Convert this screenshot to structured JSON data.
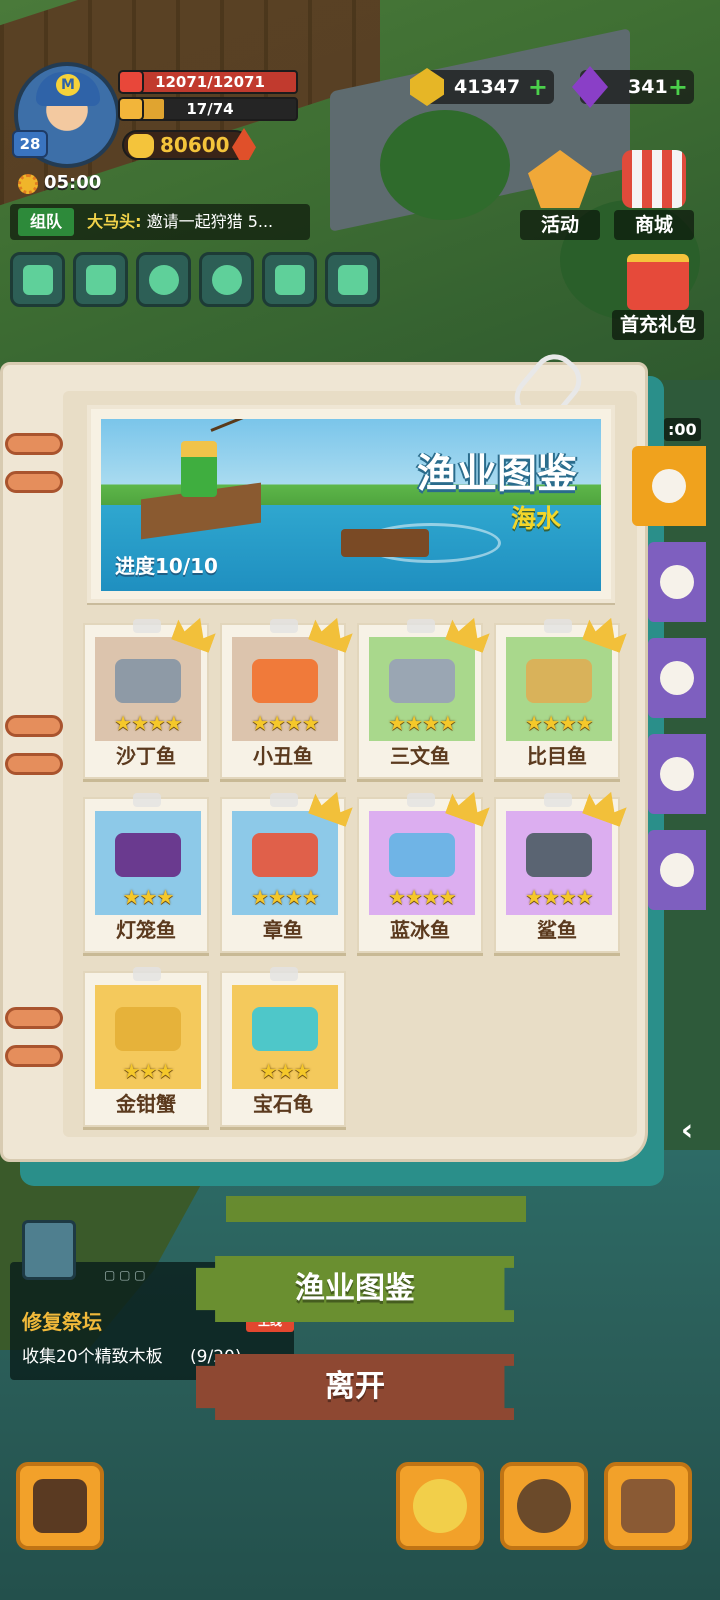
{
  "hud": {
    "player_level": "28",
    "hp_text": "12071/12071",
    "xp_text": "17/74",
    "xp_progress": 0.23,
    "power": "80600",
    "time": "05:00",
    "chat": {
      "tag": "组队",
      "sender": "大马头:",
      "message": "邀请一起狩猎 5..."
    },
    "coins": "41347",
    "gems": "341",
    "plus_symbol": "+",
    "quick_buttons": [
      "shuffle-icon",
      "mail-icon",
      "headset-icon",
      "chat-bubble-icon",
      "map-icon",
      "id-card-icon"
    ]
  },
  "shop": {
    "events_label": "活动",
    "mall_label": "商城",
    "gift_label": "首充礼包",
    "side_timer": ":00"
  },
  "codex": {
    "title": "渔业图鉴",
    "subtitle": "海水",
    "progress": "进度10/10",
    "entries": [
      {
        "name": "沙丁鱼",
        "stars": "★★★★",
        "bg": "tan",
        "crown": true,
        "sprite_color": "#8e9aa6"
      },
      {
        "name": "小丑鱼",
        "stars": "★★★★",
        "bg": "tan",
        "crown": true,
        "sprite_color": "#f07a3a"
      },
      {
        "name": "三文鱼",
        "stars": "★★★★",
        "bg": "green",
        "crown": true,
        "sprite_color": "#9aa6b3"
      },
      {
        "name": "比目鱼",
        "stars": "★★★★",
        "bg": "green",
        "crown": true,
        "sprite_color": "#d9b25a"
      },
      {
        "name": "灯笼鱼",
        "stars": "★★★",
        "bg": "blue",
        "crown": false,
        "sprite_color": "#6a3a8f"
      },
      {
        "name": "章鱼",
        "stars": "★★★★",
        "bg": "blue",
        "crown": true,
        "sprite_color": "#e0604a"
      },
      {
        "name": "蓝冰鱼",
        "stars": "★★★★",
        "bg": "purple",
        "crown": true,
        "sprite_color": "#6fb4e6"
      },
      {
        "name": "鲨鱼",
        "stars": "★★★★",
        "bg": "purple",
        "crown": true,
        "sprite_color": "#5a6472"
      },
      {
        "name": "金钳蟹",
        "stars": "★★★",
        "bg": "gold",
        "crown": false,
        "sprite_color": "#e6b23a"
      },
      {
        "name": "宝石龟",
        "stars": "★★★",
        "bg": "gold",
        "crown": false,
        "sprite_color": "#4ec7c9"
      }
    ],
    "side_tabs": [
      "fish-icon",
      "conch-icon",
      "shell-icon",
      "octopus-icon",
      "starfish-icon"
    ],
    "active_tab": 0
  },
  "menu": {
    "codex_button": "渔业图鉴",
    "leave_button": "离开"
  },
  "quest": {
    "title": "修复祭坛",
    "description": "收集20个精致木板",
    "progress": "(9/20)",
    "badge": "主线"
  },
  "bottom_bar": [
    "hammer-icon",
    "character-icon",
    "pets-icon",
    "backpack-icon"
  ]
}
